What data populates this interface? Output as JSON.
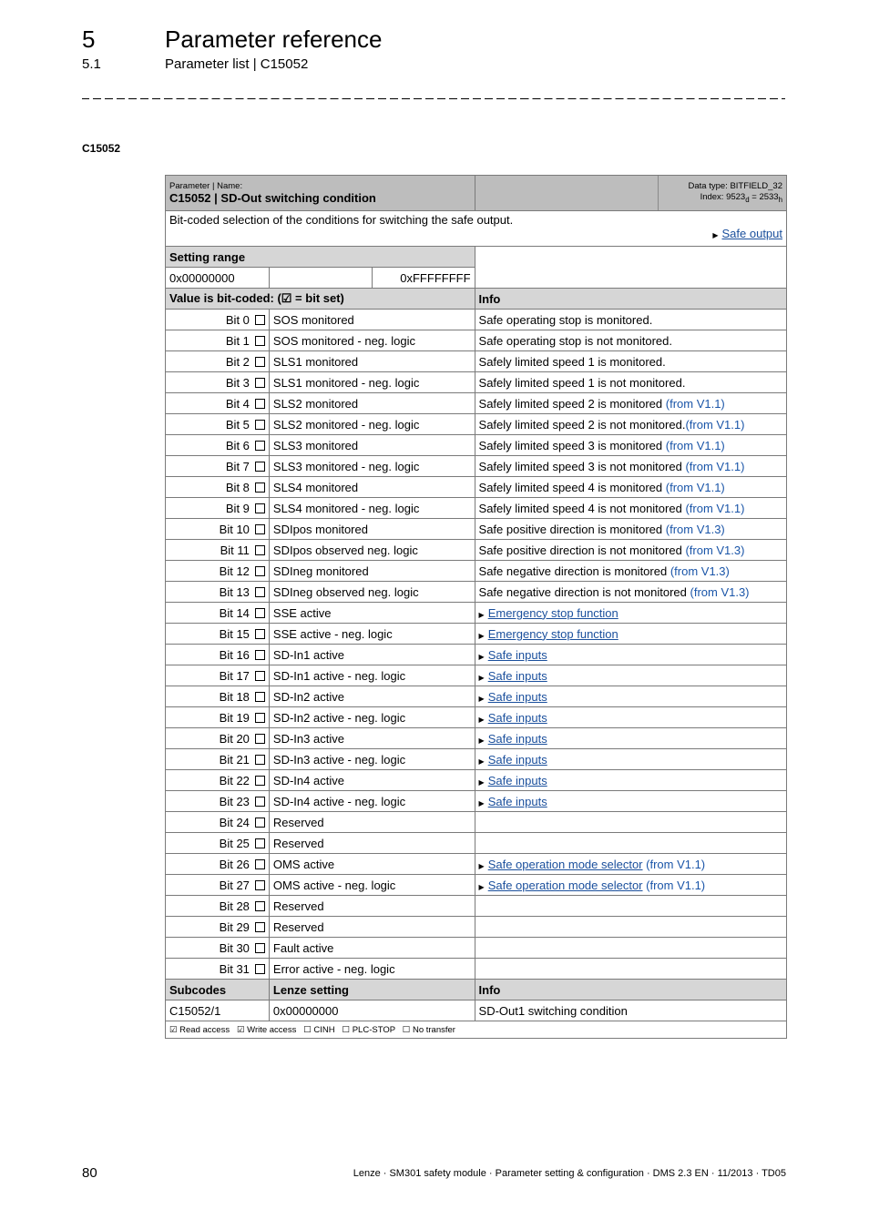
{
  "header": {
    "chapter_number": "5",
    "chapter_title": "Parameter reference",
    "section_number": "5.1",
    "section_title": "Parameter list | C15052"
  },
  "code_heading": "C15052",
  "param_table": {
    "label_param_name": "Parameter | Name:",
    "title": "C15052 | SD-Out switching condition",
    "data_type": "Data type: BITFIELD_32",
    "index_prefix": "Index: 9523",
    "index_d": "d",
    "index_mid": " = 2533",
    "index_h": "h",
    "description": "Bit-coded selection of the conditions for switching the safe output.",
    "description_link": "Safe output",
    "setting_range_label": "Setting range",
    "range_min": "0x00000000",
    "range_max": "0xFFFFFFFF",
    "bitcoded_label": "Value is bit-coded:  (☑ = bit set)",
    "info_label": "Info",
    "bits": [
      {
        "bit": "Bit 0",
        "name": "SOS monitored",
        "info": "Safe operating stop is monitored.",
        "version": "",
        "link": ""
      },
      {
        "bit": "Bit 1",
        "name": "SOS monitored - neg. logic",
        "info": "Safe operating stop is not monitored.",
        "version": "",
        "link": ""
      },
      {
        "bit": "Bit 2",
        "name": "SLS1 monitored",
        "info": "Safely limited speed 1 is monitored.",
        "version": "",
        "link": ""
      },
      {
        "bit": "Bit 3",
        "name": "SLS1 monitored - neg. logic",
        "info": "Safely limited speed 1 is not monitored.",
        "version": "",
        "link": ""
      },
      {
        "bit": "Bit 4",
        "name": "SLS2 monitored",
        "info": "Safely limited speed 2 is monitored ",
        "version": "(from V1.1)",
        "link": ""
      },
      {
        "bit": "Bit 5",
        "name": "SLS2 monitored - neg. logic",
        "info": "Safely limited speed 2 is not monitored.",
        "version": "(from V1.1)",
        "link": ""
      },
      {
        "bit": "Bit 6",
        "name": "SLS3 monitored",
        "info": "Safely limited speed 3 is monitored ",
        "version": "(from V1.1)",
        "link": ""
      },
      {
        "bit": "Bit 7",
        "name": "SLS3 monitored - neg. logic",
        "info": "Safely limited speed 3 is not monitored ",
        "version": "(from V1.1)",
        "link": ""
      },
      {
        "bit": "Bit 8",
        "name": "SLS4 monitored",
        "info": "Safely limited speed 4 is monitored ",
        "version": "(from V1.1)",
        "link": ""
      },
      {
        "bit": "Bit 9",
        "name": "SLS4 monitored - neg. logic",
        "info": "Safely limited speed 4 is not monitored ",
        "version": "(from V1.1)",
        "link": ""
      },
      {
        "bit": "Bit 10",
        "name": "SDIpos monitored",
        "info": "Safe positive direction is monitored ",
        "version": "(from V1.3)",
        "link": ""
      },
      {
        "bit": "Bit 11",
        "name": "SDIpos observed neg. logic",
        "info": "Safe positive direction is not monitored ",
        "version": "(from V1.3)",
        "link": ""
      },
      {
        "bit": "Bit 12",
        "name": "SDIneg monitored",
        "info": "Safe negative direction is monitored ",
        "version": "(from V1.3)",
        "link": ""
      },
      {
        "bit": "Bit 13",
        "name": "SDIneg observed neg. logic",
        "info": "Safe negative direction is not monitored ",
        "version": "(from V1.3)",
        "link": ""
      },
      {
        "bit": "Bit 14",
        "name": "SSE active",
        "info": "",
        "version": "",
        "link": "Emergency stop function"
      },
      {
        "bit": "Bit 15",
        "name": "SSE active - neg. logic",
        "info": "",
        "version": "",
        "link": "Emergency stop function"
      },
      {
        "bit": "Bit 16",
        "name": "SD-In1 active",
        "info": "",
        "version": "",
        "link": "Safe inputs"
      },
      {
        "bit": "Bit 17",
        "name": "SD-In1 active - neg. logic",
        "info": "",
        "version": "",
        "link": "Safe inputs"
      },
      {
        "bit": "Bit 18",
        "name": "SD-In2 active",
        "info": "",
        "version": "",
        "link": "Safe inputs"
      },
      {
        "bit": "Bit 19",
        "name": "SD-In2 active - neg. logic",
        "info": "",
        "version": "",
        "link": "Safe inputs"
      },
      {
        "bit": "Bit 20",
        "name": "SD-In3 active",
        "info": "",
        "version": "",
        "link": "Safe inputs"
      },
      {
        "bit": "Bit 21",
        "name": "SD-In3 active - neg. logic",
        "info": "",
        "version": "",
        "link": "Safe inputs"
      },
      {
        "bit": "Bit 22",
        "name": "SD-In4 active",
        "info": "",
        "version": "",
        "link": "Safe inputs"
      },
      {
        "bit": "Bit 23",
        "name": "SD-In4 active - neg. logic",
        "info": "",
        "version": "",
        "link": "Safe inputs"
      },
      {
        "bit": "Bit 24",
        "name": "Reserved",
        "info": "",
        "version": "",
        "link": ""
      },
      {
        "bit": "Bit 25",
        "name": "Reserved",
        "info": "",
        "version": "",
        "link": ""
      },
      {
        "bit": "Bit 26",
        "name": "OMS active",
        "info": "",
        "version": " (from V1.1)",
        "link": "Safe operation mode selector"
      },
      {
        "bit": "Bit 27",
        "name": "OMS active - neg. logic",
        "info": "",
        "version": " (from V1.1)",
        "link": "Safe operation mode selector"
      },
      {
        "bit": "Bit 28",
        "name": "Reserved",
        "info": "",
        "version": "",
        "link": ""
      },
      {
        "bit": "Bit 29",
        "name": "Reserved",
        "info": "",
        "version": "",
        "link": ""
      },
      {
        "bit": "Bit 30",
        "name": "Fault active",
        "info": "",
        "version": "",
        "link": ""
      },
      {
        "bit": "Bit 31",
        "name": "Error active - neg. logic",
        "info": "",
        "version": "",
        "link": ""
      }
    ],
    "subcodes_label": "Subcodes",
    "lenze_setting_label": "Lenze setting",
    "subcode_info_label": "Info",
    "subcodes": [
      {
        "code": "C15052/1",
        "setting": "0x00000000",
        "info": "SD-Out1 switching condition"
      }
    ],
    "access": "☑ Read access   ☑ Write access   ☐ CINH   ☐ PLC-STOP   ☐ No transfer"
  },
  "footer": {
    "page_number": "80",
    "text": "Lenze · SM301 safety module · Parameter setting & configuration · DMS 2.3 EN · 11/2013 · TD05"
  }
}
